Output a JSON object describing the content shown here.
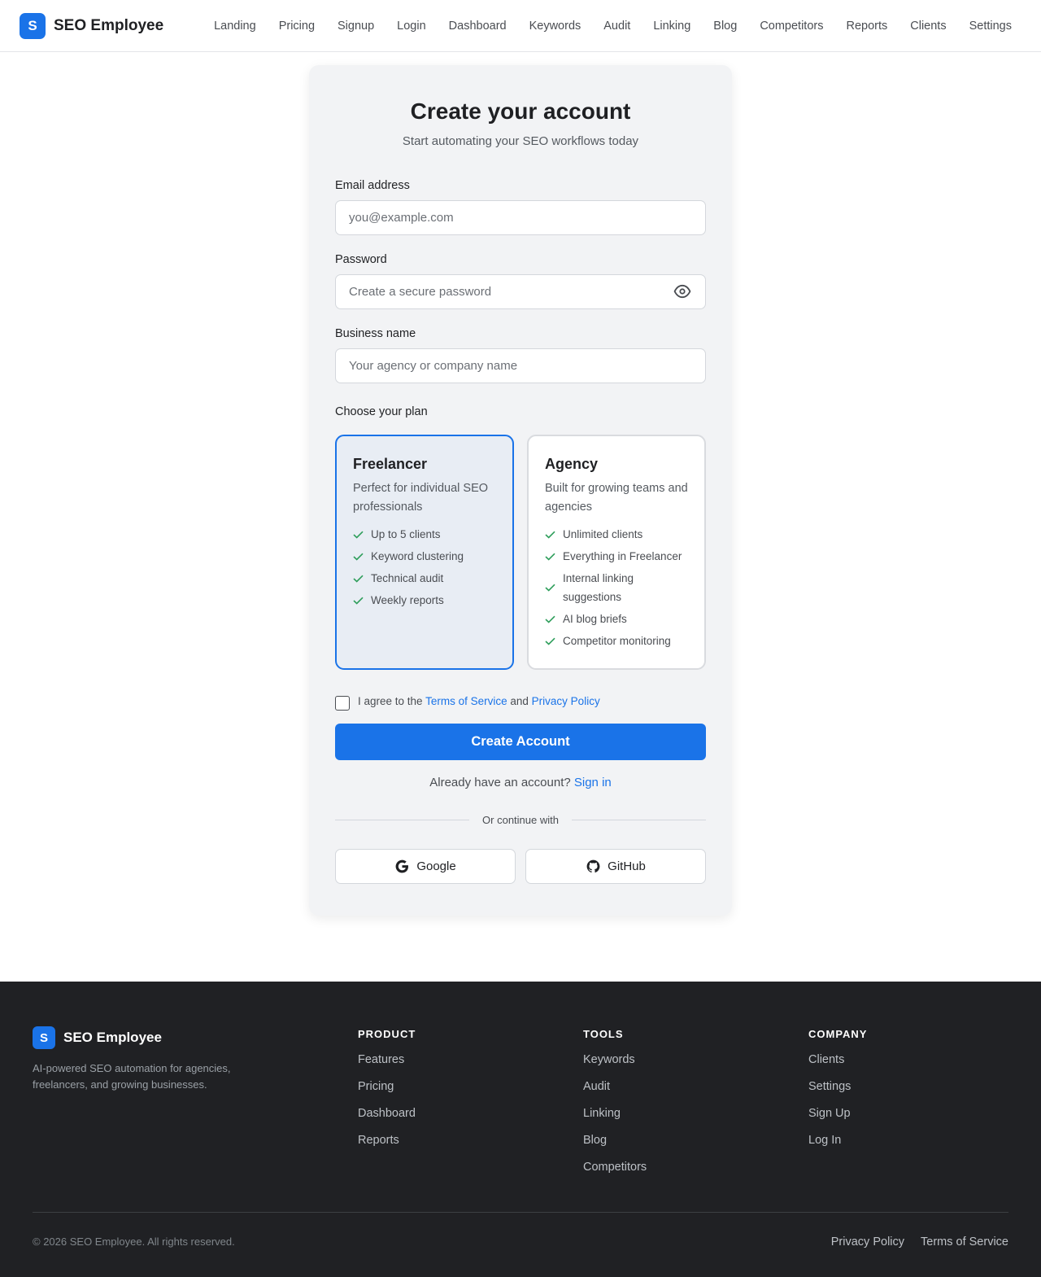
{
  "header": {
    "logo_letter": "S",
    "brand": "SEO Employee",
    "nav": [
      "Landing",
      "Pricing",
      "Signup",
      "Login",
      "Dashboard",
      "Keywords",
      "Audit",
      "Linking",
      "Blog",
      "Competitors",
      "Reports",
      "Clients",
      "Settings"
    ]
  },
  "form": {
    "title": "Create your account",
    "subtitle": "Start automating your SEO workflows today",
    "email": {
      "label": "Email address",
      "placeholder": "you@example.com",
      "value": ""
    },
    "password": {
      "label": "Password",
      "placeholder": "Create a secure password",
      "value": ""
    },
    "business": {
      "label": "Business name",
      "placeholder": "Your agency or company name",
      "value": ""
    },
    "plan_label": "Choose your plan",
    "plans": [
      {
        "name": "Freelancer",
        "desc": "Perfect for individual SEO professionals",
        "selected": true,
        "features": [
          "Up to 5 clients",
          "Keyword clustering",
          "Technical audit",
          "Weekly reports"
        ]
      },
      {
        "name": "Agency",
        "desc": "Built for growing teams and agencies",
        "selected": false,
        "features": [
          "Unlimited clients",
          "Everything in Freelancer",
          "Internal linking suggestions",
          "AI blog briefs",
          "Competitor monitoring"
        ]
      }
    ],
    "agree_prefix": "I agree to the",
    "terms": "Terms of Service",
    "agree_mid": "and",
    "privacy": "Privacy Policy",
    "agree_checked": false,
    "submit": "Create Account",
    "signin_prefix": "Already have an account?",
    "signin_link": "Sign in",
    "divider": "Or continue with",
    "socials": [
      {
        "label": "Google",
        "icon": "google-icon"
      },
      {
        "label": "GitHub",
        "icon": "github-icon"
      }
    ]
  },
  "footer": {
    "logo_letter": "S",
    "brand": "SEO Employee",
    "tagline": "AI-powered SEO automation for agencies, freelancers, and growing businesses.",
    "columns": [
      {
        "title": "PRODUCT",
        "links": [
          "Features",
          "Pricing",
          "Dashboard",
          "Reports"
        ]
      },
      {
        "title": "TOOLS",
        "links": [
          "Keywords",
          "Audit",
          "Linking",
          "Blog",
          "Competitors"
        ]
      },
      {
        "title": "COMPANY",
        "links": [
          "Clients",
          "Settings",
          "Sign Up",
          "Log In"
        ]
      }
    ],
    "copyright": "© 2026 SEO Employee. All rights reserved.",
    "legal": [
      "Privacy Policy",
      "Terms of Service"
    ]
  },
  "colors": {
    "accent": "#1a73e8",
    "check": "#2e9e5b",
    "footer_bg": "#202124",
    "card_bg": "#f2f3f5"
  }
}
